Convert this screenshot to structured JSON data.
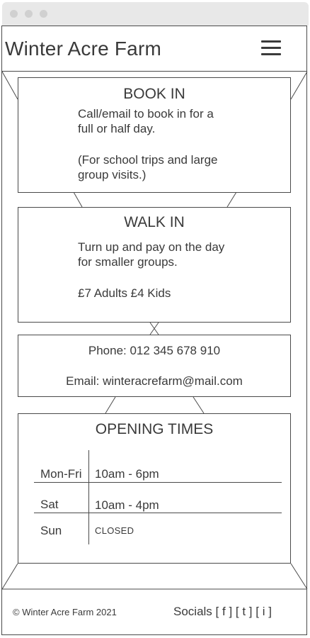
{
  "site": {
    "title": "Winter Acre Farm"
  },
  "header": {
    "menu_icon": "hamburger-menu-icon"
  },
  "book_in": {
    "title": "BOOK IN",
    "line1": "Call/email to book in for a",
    "line2": "full or half day.",
    "line3": "(For school trips and large",
    "line4": "group visits.)"
  },
  "walk_in": {
    "title": "WALK IN",
    "line1": "Turn up and pay on the day",
    "line2": "for smaller groups.",
    "prices": "£7 Adults £4 Kids"
  },
  "contact": {
    "phone": "Phone: 012 345 678 910",
    "email": "Email: winteracrefarm@mail.com"
  },
  "opening_times": {
    "title": "OPENING TIMES",
    "rows": [
      {
        "day": "Mon-Fri",
        "hours": "10am - 6pm"
      },
      {
        "day": "Sat",
        "hours": "10am - 4pm"
      },
      {
        "day": "Sun",
        "hours": "CLOSED"
      }
    ]
  },
  "footer": {
    "copyright": "© Winter Acre Farm 2021",
    "socials_label": "Socials",
    "socials": [
      "[ f ]",
      "[ t ]",
      "[ i ]"
    ]
  },
  "colors": {
    "line": "#4a4a4a",
    "text": "#3a3a3a",
    "titlebar": "#e8e8e8"
  }
}
